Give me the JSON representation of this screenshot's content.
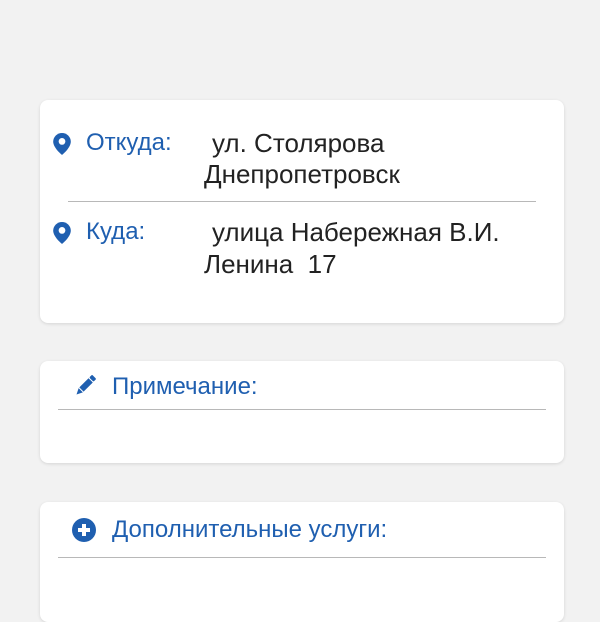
{
  "route": {
    "from": {
      "label": "Откуда:",
      "line1": "ул. Столярова",
      "line2": "Днепропетровск"
    },
    "to": {
      "label": "Куда:",
      "line1": "улица Набережная В.И.",
      "line2": "Ленина  17"
    },
    "icon": "location-pin-icon"
  },
  "note": {
    "title": "Примечание:",
    "icon": "pencil-icon"
  },
  "services": {
    "title": "Дополнительные услуги:",
    "icon": "plus-circle-icon"
  },
  "colors": {
    "accent": "#1f5fb0",
    "background": "#f2f2f2",
    "card": "#ffffff",
    "text": "#222222"
  }
}
